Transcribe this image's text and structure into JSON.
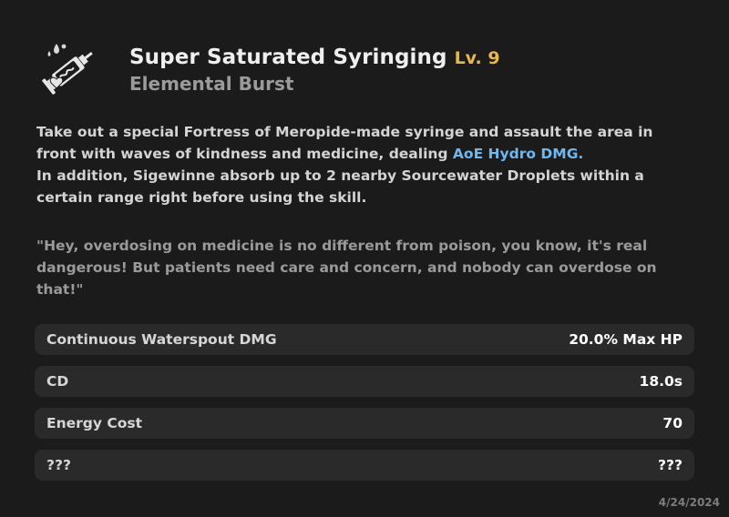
{
  "skill": {
    "name": "Super Saturated Syringing",
    "level": "Lv. 9",
    "type": "Elemental Burst",
    "icon": "syringe-burst-icon"
  },
  "description": {
    "line1_a": "Take out a special Fortress of Meropide-made syringe and assault the area in front with waves of kindness and medicine, dealing ",
    "line1_highlight": "AoE Hydro DMG.",
    "line2": "In addition, Sigewinne absorb up to 2 nearby Sourcewater Droplets within a certain range right before using the skill.",
    "quote": "\"Hey, overdosing on medicine is no different from poison, you know, it's real dangerous! But patients need care and concern, and nobody can overdose on that!\""
  },
  "stats": [
    {
      "label": "Continuous Waterspout DMG",
      "value": "20.0% Max HP"
    },
    {
      "label": "CD",
      "value": "18.0s"
    },
    {
      "label": "Energy Cost",
      "value": "70"
    },
    {
      "label": "???",
      "value": "???"
    }
  ],
  "date": "4/24/2024",
  "colors": {
    "background": "#1b1b1b",
    "level": "#e9b64a",
    "hydro": "#6fb7ee",
    "row": "#2a2a2a"
  }
}
